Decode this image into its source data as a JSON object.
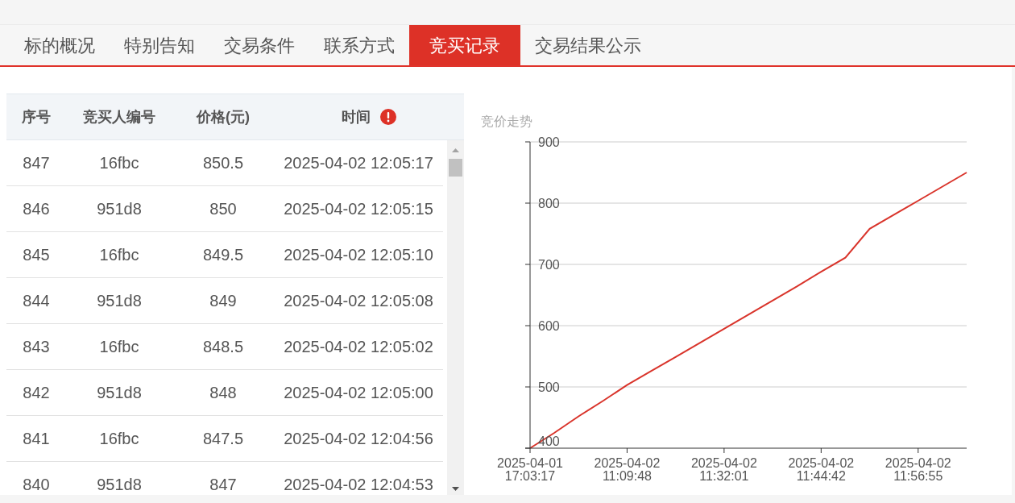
{
  "tabs": [
    {
      "label": "标的概况",
      "selected": false
    },
    {
      "label": "特别告知",
      "selected": false
    },
    {
      "label": "交易条件",
      "selected": false
    },
    {
      "label": "联系方式",
      "selected": false
    },
    {
      "label": "竞买记录",
      "selected": true
    },
    {
      "label": "交易结果公示",
      "selected": false
    }
  ],
  "bid_table": {
    "columns": [
      {
        "label": "序号",
        "info_icon": false
      },
      {
        "label": "竞买人编号",
        "info_icon": false
      },
      {
        "label": "价格(元)",
        "info_icon": false
      },
      {
        "label": "时间",
        "info_icon": true
      }
    ],
    "rows": [
      [
        "847",
        "16fbc",
        "850.5",
        "2025-04-02 12:05:17"
      ],
      [
        "846",
        "951d8",
        "850",
        "2025-04-02 12:05:15"
      ],
      [
        "845",
        "16fbc",
        "849.5",
        "2025-04-02 12:05:10"
      ],
      [
        "844",
        "951d8",
        "849",
        "2025-04-02 12:05:08"
      ],
      [
        "843",
        "16fbc",
        "848.5",
        "2025-04-02 12:05:02"
      ],
      [
        "842",
        "951d8",
        "848",
        "2025-04-02 12:05:00"
      ],
      [
        "841",
        "16fbc",
        "847.5",
        "2025-04-02 12:04:56"
      ],
      [
        "840",
        "951d8",
        "847",
        "2025-04-02 12:04:53"
      ]
    ]
  },
  "chart": {
    "chart_data": {
      "type": "line",
      "title": "竞价走势",
      "grid": true,
      "categories": [
        "2025-04-01 17:03:17",
        null,
        null,
        null,
        "2025-04-02 11:09:48",
        null,
        null,
        null,
        "2025-04-02 11:32:01",
        null,
        null,
        null,
        "2025-04-02 11:44:42",
        null,
        null,
        null,
        "2025-04-02 11:56:55",
        null,
        null
      ],
      "series": [
        {
          "color": "#d9342b",
          "values": [
            400,
            425,
            452,
            477,
            503,
            526,
            549,
            572,
            595,
            618,
            641,
            664,
            688,
            711,
            758,
            781,
            804,
            827,
            850
          ]
        }
      ],
      "ylim": [
        400,
        900
      ],
      "yticks": [
        400,
        500,
        600,
        700,
        800,
        900
      ]
    }
  }
}
